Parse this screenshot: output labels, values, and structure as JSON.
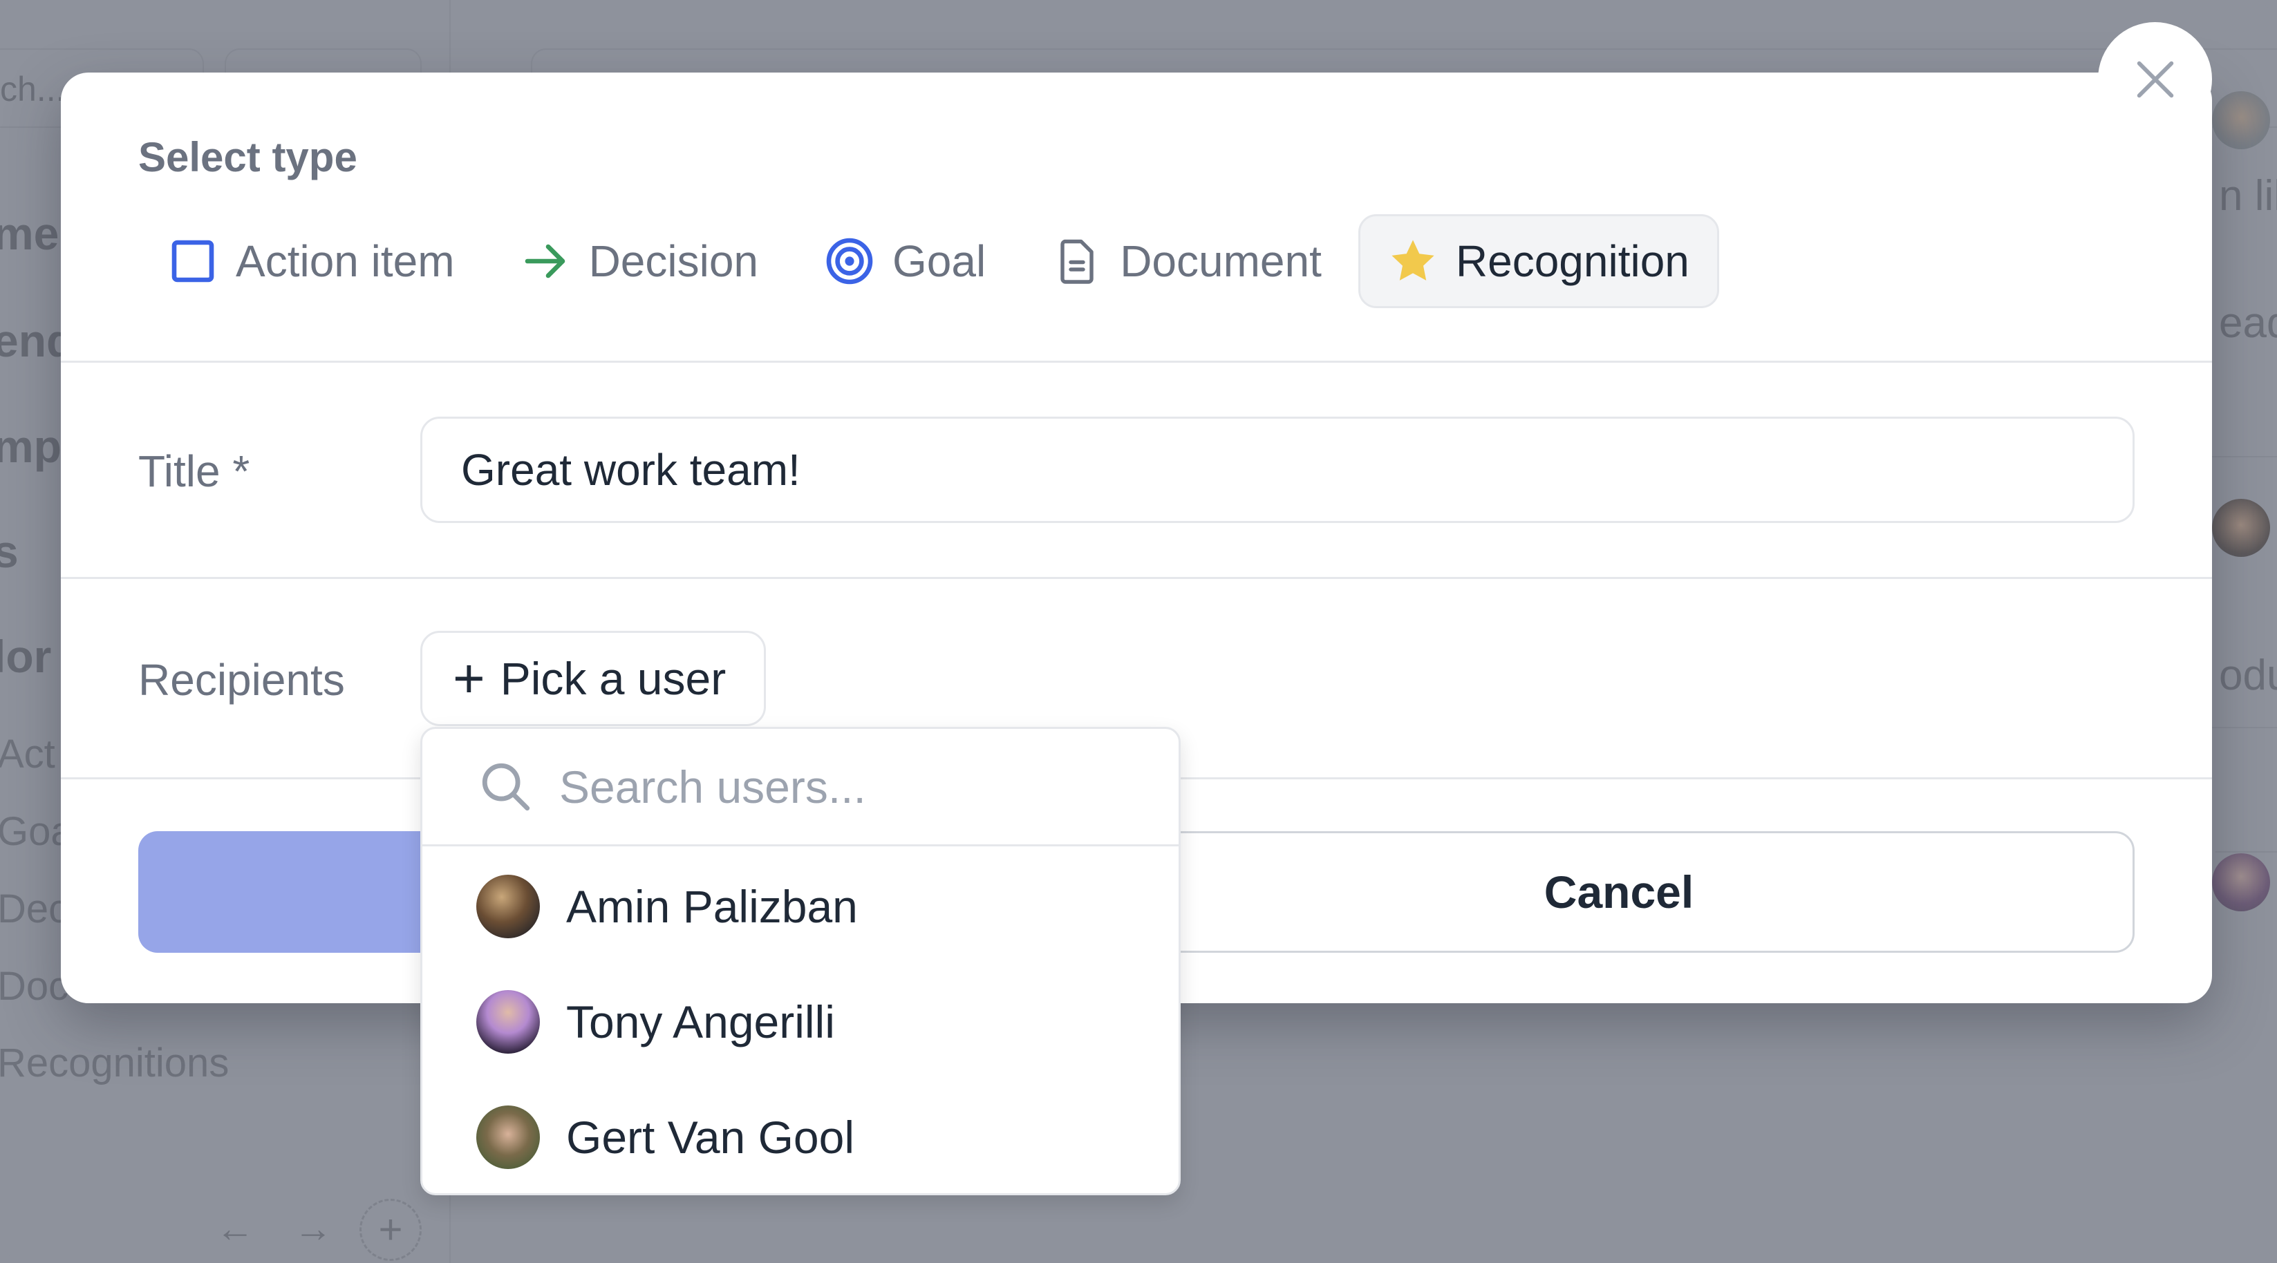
{
  "background": {
    "search_placeholder_fragment": "ch...",
    "sidebar_fragments": [
      "me",
      "end",
      "mpl",
      "s",
      "lor"
    ],
    "sidebar_sub_fragments": [
      "Act",
      "Goa",
      "Dec",
      "Doc",
      "Recognitions"
    ],
    "nav": {
      "back_icon": "←",
      "forward_icon": "→",
      "add_icon": "+"
    },
    "right_fragments": [
      "n lik",
      "ead",
      "odu"
    ]
  },
  "modal": {
    "close_icon": "close-icon",
    "select_type_label": "Select type",
    "types": [
      {
        "id": "action-item",
        "label": "Action item",
        "icon": "checkbox-icon",
        "color": "#3b63e6",
        "selected": false
      },
      {
        "id": "decision",
        "label": "Decision",
        "icon": "arrow-right-icon",
        "color": "#3a9a5c",
        "selected": false
      },
      {
        "id": "goal",
        "label": "Goal",
        "icon": "target-icon",
        "color": "#3b63e6",
        "selected": false
      },
      {
        "id": "document",
        "label": "Document",
        "icon": "document-icon",
        "color": "#6b7280",
        "selected": false
      },
      {
        "id": "recognition",
        "label": "Recognition",
        "icon": "star-icon",
        "color": "#f2c94c",
        "selected": true
      }
    ],
    "title_field": {
      "label": "Title *",
      "value": "Great work team!"
    },
    "recipients_field": {
      "label": "Recipients",
      "button_label": "Pick a user",
      "button_icon": "+"
    },
    "footer": {
      "submit_label": "",
      "cancel_label": "Cancel",
      "submit_color": "#96a5e8"
    }
  },
  "user_picker": {
    "search_placeholder": "Search users...",
    "users": [
      {
        "name": "Amin Palizban"
      },
      {
        "name": "Tony Angerilli"
      },
      {
        "name": "Gert Van Gool"
      }
    ]
  }
}
